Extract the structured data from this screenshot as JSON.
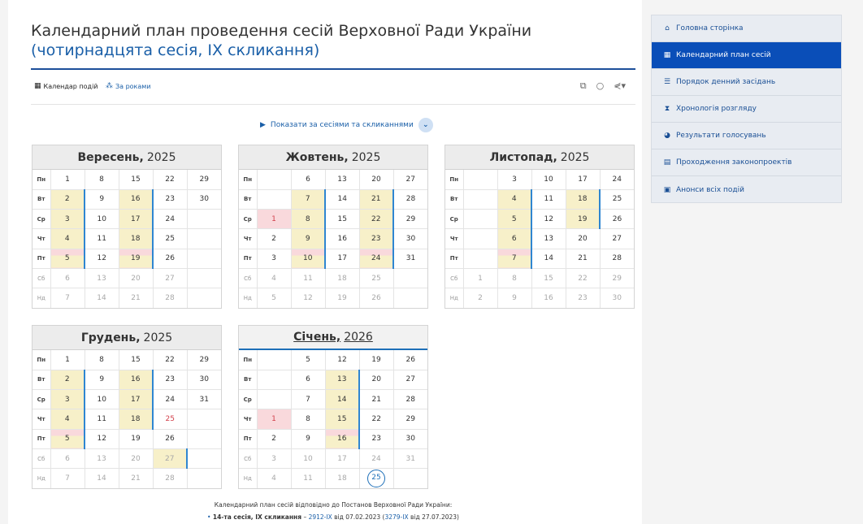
{
  "header": {
    "title": "Календарний план проведення сесій Верховної Ради України",
    "subtitle": "(чотирнадцята сесія, IX скликання)"
  },
  "toolbar": {
    "calendar_label": "Календар подій",
    "years_label": "За роками"
  },
  "toggle": {
    "label": "Показати за сесіями та скликаннями"
  },
  "weekdays": [
    "Пн",
    "Вт",
    "Ср",
    "Чт",
    "Пт",
    "Сб",
    "Нд"
  ],
  "months": [
    {
      "name": "Вересень,",
      "year": "2025",
      "weeks": [
        [
          "1",
          "2",
          "3",
          "4",
          "5",
          "6",
          "7"
        ],
        [
          "8",
          "9",
          "10",
          "11",
          "12",
          "13",
          "14"
        ],
        [
          "15",
          "16",
          "17",
          "18",
          "19",
          "20",
          "21"
        ],
        [
          "22",
          "23",
          "24",
          "25",
          "26",
          "27",
          "28"
        ],
        [
          "29",
          "30",
          "",
          "",
          "",
          "",
          ""
        ]
      ]
    },
    {
      "name": "Жовтень,",
      "year": "2025",
      "weeks": [
        [
          "",
          "",
          "1",
          "2",
          "3",
          "4",
          "5"
        ],
        [
          "6",
          "7",
          "8",
          "9",
          "10",
          "11",
          "12"
        ],
        [
          "13",
          "14",
          "15",
          "16",
          "17",
          "18",
          "19"
        ],
        [
          "20",
          "21",
          "22",
          "23",
          "24",
          "25",
          "26"
        ],
        [
          "27",
          "28",
          "29",
          "30",
          "31",
          "",
          ""
        ]
      ]
    },
    {
      "name": "Листопад,",
      "year": "2025",
      "weeks": [
        [
          "",
          "",
          "",
          "",
          "",
          "1",
          "2"
        ],
        [
          "3",
          "4",
          "5",
          "6",
          "7",
          "8",
          "9"
        ],
        [
          "10",
          "11",
          "12",
          "13",
          "14",
          "15",
          "16"
        ],
        [
          "17",
          "18",
          "19",
          "20",
          "21",
          "22",
          "23"
        ],
        [
          "24",
          "25",
          "26",
          "27",
          "28",
          "29",
          "30"
        ]
      ]
    },
    {
      "name": "Грудень,",
      "year": "2025",
      "weeks": [
        [
          "1",
          "2",
          "3",
          "4",
          "5",
          "6",
          "7"
        ],
        [
          "8",
          "9",
          "10",
          "11",
          "12",
          "13",
          "14"
        ],
        [
          "15",
          "16",
          "17",
          "18",
          "19",
          "20",
          "21"
        ],
        [
          "22",
          "23",
          "24",
          "25",
          "26",
          "27",
          "28"
        ],
        [
          "29",
          "30",
          "31",
          "",
          "",
          "",
          ""
        ]
      ]
    },
    {
      "name": "Січень,",
      "year": "2026",
      "weeks": [
        [
          "",
          "",
          "",
          "1",
          "2",
          "3",
          "4"
        ],
        [
          "5",
          "6",
          "7",
          "8",
          "9",
          "10",
          "11"
        ],
        [
          "12",
          "13",
          "14",
          "15",
          "16",
          "17",
          "18"
        ],
        [
          "19",
          "20",
          "21",
          "22",
          "23",
          "24",
          "25"
        ],
        [
          "26",
          "27",
          "28",
          "29",
          "30",
          "31",
          ""
        ]
      ]
    }
  ],
  "footer": {
    "line1": "Календарний план сесій відповідно до Постанов Верховної Ради України:",
    "session_label": "14-та сесія, IX скликання",
    "dash": "–",
    "resolution1": "2912-IX",
    "date1": "від 07.02.2023",
    "resolution2": "3279-IX",
    "date2": "від 27.07.2023"
  },
  "sidebar": {
    "items": [
      {
        "label": "Головна сторінка",
        "icon": "home-icon",
        "glyph": "⌂"
      },
      {
        "label": "Календарний план сесій",
        "icon": "calendar-icon",
        "glyph": "▦"
      },
      {
        "label": "Порядок денний засідань",
        "icon": "list-icon",
        "glyph": "☰"
      },
      {
        "label": "Хронологія розгляду",
        "icon": "hourglass-icon",
        "glyph": "⧗"
      },
      {
        "label": "Результати голосувань",
        "icon": "pie-chart-icon",
        "glyph": "◕"
      },
      {
        "label": "Проходження законопроектів",
        "icon": "document-icon",
        "glyph": "▤"
      },
      {
        "label": "Анонси всіх подій",
        "icon": "newspaper-icon",
        "glyph": "▣"
      }
    ]
  },
  "colors": {
    "accent": "#0a4eb8",
    "plenary": "#f7f0c9",
    "special": "#f9d9dc",
    "marker": "#2f86d1"
  }
}
